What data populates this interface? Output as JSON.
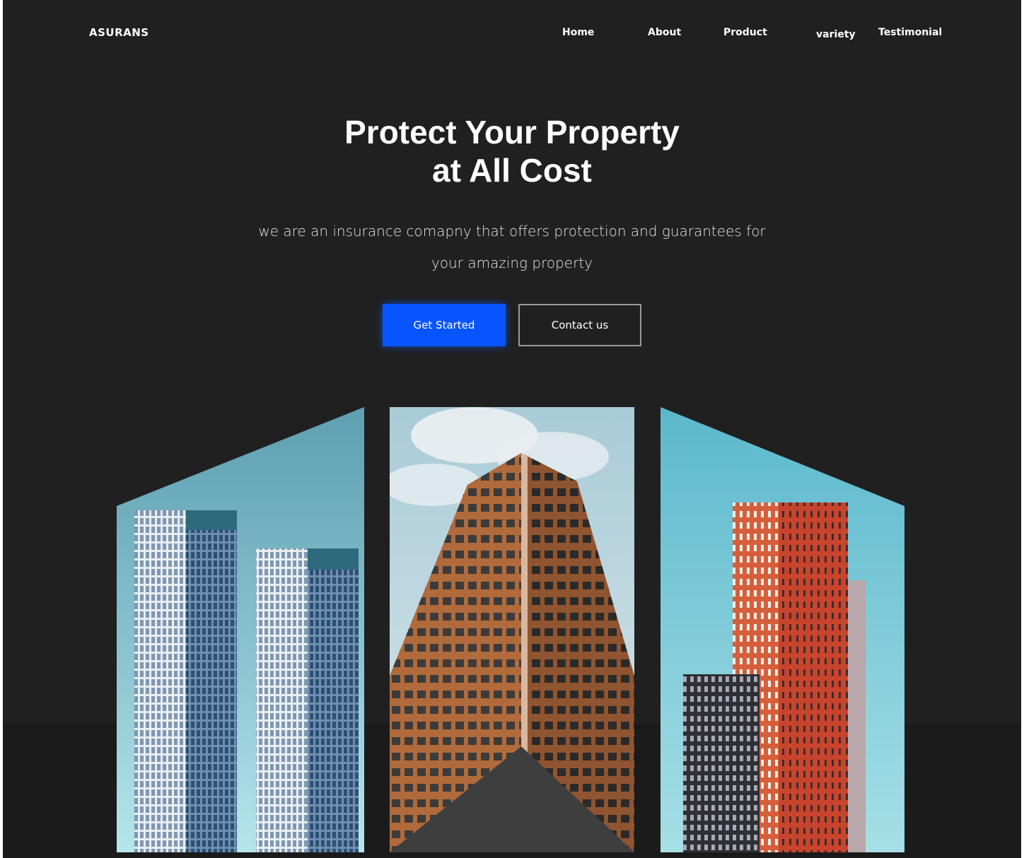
{
  "brand": {
    "logo_text": "ASURANS"
  },
  "nav": {
    "items": [
      {
        "label": "Home"
      },
      {
        "label": "About"
      },
      {
        "label": "Product"
      },
      {
        "label": "variety"
      },
      {
        "label": "Testimonial"
      }
    ]
  },
  "hero": {
    "title_line1": "Protect Your Property",
    "title_line2": "at All Cost",
    "description_line1": "we are an insurance comapny that offers protection and guarantees for",
    "description_line2": "your amazing property",
    "primary_button": "Get Started",
    "secondary_button": "Contact us"
  },
  "colors": {
    "background": "#202020",
    "accent": "#0855ff",
    "text": "#ffffff",
    "secondary_border": "#9a9a9a"
  },
  "images": [
    {
      "icon": "twin-glass-towers-photo"
    },
    {
      "icon": "brown-tower-upward-photo"
    },
    {
      "icon": "red-tower-building-photo"
    }
  ]
}
